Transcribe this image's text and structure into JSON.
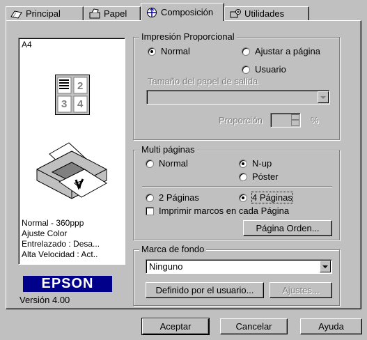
{
  "tabs": [
    {
      "label": "Principal",
      "icon": "page-icon",
      "active": false
    },
    {
      "label": "Papel",
      "icon": "paper-icon",
      "active": false
    },
    {
      "label": "Composición",
      "icon": "layout-icon",
      "active": true
    },
    {
      "label": "Utilidades",
      "icon": "tools-icon",
      "active": false
    }
  ],
  "preview": {
    "paper_size": "A4",
    "page_numbers": [
      "2",
      "3",
      "4"
    ],
    "info_lines": [
      "Normal - 360ppp",
      "Ajuste Color",
      "Entrelazado : Desa...",
      "Alta Velocidad : Act.."
    ],
    "brand": "EPSON",
    "version": "Versión 4.00"
  },
  "proportional": {
    "title": "Impresión Proporcional",
    "normal": "Normal",
    "fit_page": "Ajustar a página",
    "user": "Usuario",
    "output_size_label": "Tamaño del papel de salida",
    "output_size_value": "",
    "proportion_label": "Proporción",
    "proportion_value": "",
    "percent": "%",
    "selected": "normal"
  },
  "multipage": {
    "title": "Multi páginas",
    "normal": "Normal",
    "nup": "N-up",
    "poster": "Póster",
    "selected": "nup",
    "two_pages": "2 Páginas",
    "four_pages": "4 Páginas",
    "pages_selected": "4",
    "print_frames": "Imprimir marcos en cada Página",
    "print_frames_checked": false,
    "page_order_button": "Página Orden..."
  },
  "watermark": {
    "title": "Marca de fondo",
    "value": "Ninguno",
    "user_defined_button": "Definido por el usuario...",
    "settings_button": "Ajustes..."
  },
  "footer": {
    "ok": "Aceptar",
    "cancel": "Cancelar",
    "help": "Ayuda"
  },
  "colors": {
    "face": "#c0c0c0",
    "shadow": "#808080",
    "brand": "#00008b"
  }
}
